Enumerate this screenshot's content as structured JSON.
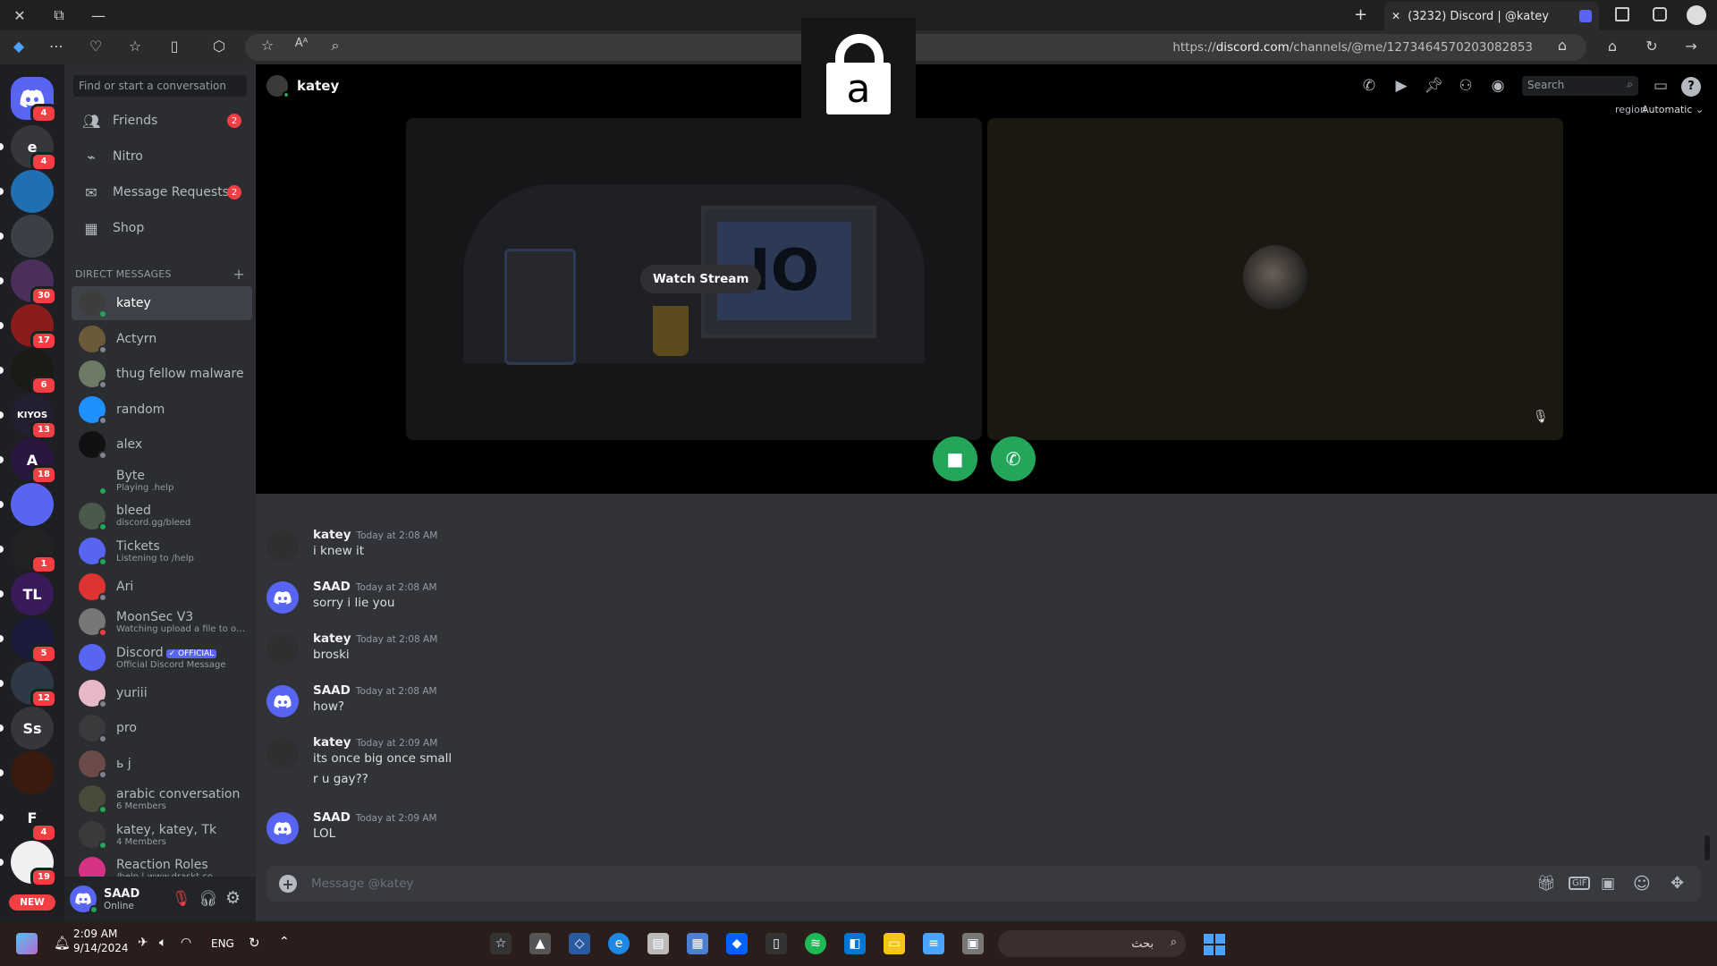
{
  "browser": {
    "tab_title": "(3232) Discord | @katey",
    "url_prefix": "https://",
    "url_domain": "discord.com",
    "url_path": "/channels/@me/1273464570203082853"
  },
  "overlay": {
    "letter": "a"
  },
  "servers": [
    {
      "label": "",
      "badge": "4",
      "color": "#5865f2",
      "icon": "discord-home-icon"
    },
    {
      "label": "e",
      "badge": "4",
      "color": "#36373d"
    },
    {
      "label": "",
      "badge": "",
      "color": "#1f6fb2"
    },
    {
      "label": "",
      "badge": "",
      "color": "#3c3f45"
    },
    {
      "label": "",
      "badge": "30",
      "color": "#4a2f5c"
    },
    {
      "label": "",
      "badge": "17",
      "color": "#8a1c1c"
    },
    {
      "label": "",
      "badge": "6",
      "color": "#1c1a14"
    },
    {
      "label": "KIYOS",
      "badge": "13",
      "color": "#202030"
    },
    {
      "label": "A",
      "badge": "18",
      "color": "#2a1640"
    },
    {
      "label": "",
      "badge": "",
      "color": "#5865f2"
    },
    {
      "label": "",
      "badge": "1",
      "color": "#222"
    },
    {
      "label": "TL",
      "badge": "",
      "color": "#3a1b5a"
    },
    {
      "label": "",
      "badge": "5",
      "color": "#1a1a3a"
    },
    {
      "label": "",
      "badge": "12",
      "color": "#2d3a46"
    },
    {
      "label": "Ss",
      "badge": "",
      "color": "#36373d"
    },
    {
      "label": "",
      "badge": "",
      "color": "#3b1a10"
    },
    {
      "label": "F",
      "badge": "4",
      "color": "#1e1f22"
    },
    {
      "label": "",
      "badge": "19",
      "color": "#f0f0f0"
    }
  ],
  "new_label": "NEW",
  "search_placeholder": "Find or start a conversation",
  "nav": [
    {
      "label": "Friends",
      "badge": "2",
      "icon": "friends-icon"
    },
    {
      "label": "Nitro",
      "badge": "",
      "icon": "nitro-icon"
    },
    {
      "label": "Message Requests",
      "badge": "2",
      "icon": "envelope-icon"
    },
    {
      "label": "Shop",
      "badge": "",
      "icon": "shop-icon"
    }
  ],
  "dm_header": "DIRECT MESSAGES",
  "dms": [
    {
      "name": "katey",
      "sub": "",
      "color": "#3d3d3d",
      "status": "#23a55a",
      "active": true
    },
    {
      "name": "Actyrn",
      "sub": "",
      "color": "#6b5a3a",
      "status": "#80848e"
    },
    {
      "name": "thug fellow malware",
      "sub": "",
      "color": "#6d7a66",
      "status": "#80848e"
    },
    {
      "name": "random",
      "sub": "",
      "color": "#1e90ff",
      "status": "#80848e"
    },
    {
      "name": "alex",
      "sub": "",
      "color": "#111111",
      "status": "#80848e"
    },
    {
      "name": "Byte",
      "sub": "Playing .help",
      "color": "#2b2d31",
      "status": "#23a55a"
    },
    {
      "name": "bleed",
      "sub": "discord.gg/bleed",
      "color": "#4a5a4a",
      "status": "#23a55a"
    },
    {
      "name": "Tickets",
      "sub": "Listening to /help",
      "color": "#5865f2",
      "status": "#23a55a"
    },
    {
      "name": "Ari",
      "sub": "",
      "color": "#d33",
      "status": "#80848e"
    },
    {
      "name": "MoonSec V3",
      "sub": "Watching upload a file to obfu...",
      "color": "#777",
      "status": "#f23f43"
    },
    {
      "name": "Discord",
      "official": "OFFICIAL",
      "sub": "Official Discord Message",
      "color": "#5865f2",
      "status": ""
    },
    {
      "name": "yuriii",
      "sub": "",
      "color": "#e8b8c8",
      "status": "#80848e"
    },
    {
      "name": "pro",
      "sub": "",
      "color": "#3a3a3a",
      "status": "#80848e"
    },
    {
      "name": "ь j",
      "sub": "",
      "color": "#6b4a4a",
      "status": "#80848e"
    },
    {
      "name": "arabic conversation",
      "sub": "6 Members",
      "color": "#4a4a3a",
      "status": "#23a55a"
    },
    {
      "name": "katey, katey, Tk",
      "sub": "4 Members",
      "color": "#3a3a3a",
      "status": "#23a55a"
    },
    {
      "name": "Reaction Roles",
      "sub": "/help | www.draskt.co",
      "color": "#d63384",
      "status": ""
    }
  ],
  "user": {
    "name": "SAAD",
    "status": "Online"
  },
  "chat": {
    "recipient": "katey",
    "search_placeholder": "Search",
    "region_label": "region",
    "region_value": "Automatic",
    "watch_stream": "Watch Stream",
    "composer_placeholder": "Message @katey",
    "messages": [
      {
        "author": "katey",
        "time": "Today at 2:08 AM",
        "lines": [
          "i knew it"
        ],
        "avatar": "#2f2f2f"
      },
      {
        "author": "SAAD",
        "time": "Today at 2:08 AM",
        "lines": [
          "sorry i lie you"
        ],
        "avatar": "#5865f2"
      },
      {
        "author": "katey",
        "time": "Today at 2:08 AM",
        "lines": [
          "broski"
        ],
        "avatar": "#2f2f2f"
      },
      {
        "author": "SAAD",
        "time": "Today at 2:08 AM",
        "lines": [
          "how?"
        ],
        "avatar": "#5865f2"
      },
      {
        "author": "katey",
        "time": "Today at 2:09 AM",
        "lines": [
          "its once big once small",
          "r u gay??"
        ],
        "avatar": "#2f2f2f"
      },
      {
        "author": "SAAD",
        "time": "Today at 2:09 AM",
        "lines": [
          "LOL"
        ],
        "avatar": "#5865f2"
      }
    ]
  },
  "taskbar": {
    "time": "2:09 AM",
    "date": "9/14/2024",
    "lang": "ENG",
    "search_text": "بحث"
  },
  "colors": {
    "blurple": "#5865f2",
    "green": "#23a55a",
    "red": "#f23f43"
  }
}
